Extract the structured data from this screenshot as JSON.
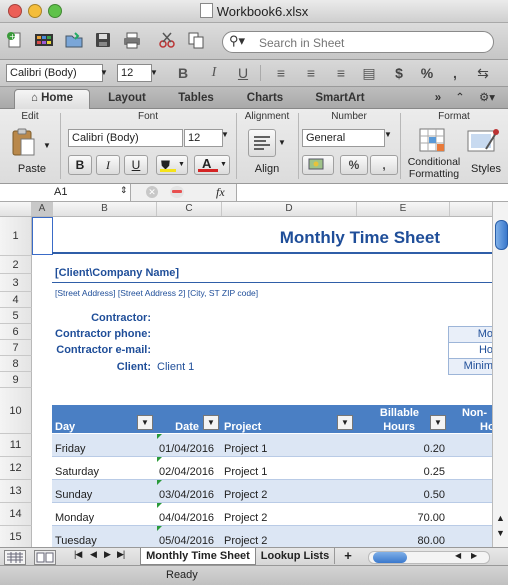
{
  "window": {
    "title": "Workbook6.xlsx"
  },
  "toolbar": {
    "search_placeholder": "Search in Sheet"
  },
  "formatbar": {
    "font_name": "Calibri (Body)",
    "font_size": "12",
    "bold": "B",
    "italic": "I",
    "underline": "U",
    "currency": "$",
    "percent": "%",
    "comma": ","
  },
  "ribbon_tabs": [
    "Home",
    "Layout",
    "Tables",
    "Charts",
    "SmartArt"
  ],
  "ribbon": {
    "groups": {
      "edit": "Edit",
      "font": "Font",
      "alignment": "Alignment",
      "number": "Number",
      "format": "Format"
    },
    "paste_label": "Paste",
    "font_name": "Calibri (Body)",
    "font_size": "12",
    "bold": "B",
    "italic": "I",
    "underline": "U",
    "align_label": "Align",
    "number_format": "General",
    "percent": "%",
    "comma": ",",
    "conditional_line1": "Conditional",
    "conditional_line2": "Formatting",
    "styles_label": "Styles"
  },
  "formula_bar": {
    "cell_ref": "A1",
    "fx": "fx"
  },
  "columns": [
    "A",
    "B",
    "C",
    "D",
    "E"
  ],
  "rows": [
    "1",
    "2",
    "3",
    "4",
    "5",
    "6",
    "7",
    "8",
    "9",
    "10",
    "11",
    "12",
    "13",
    "14",
    "15"
  ],
  "sheet": {
    "title": "Monthly Time Sheet",
    "company": "[Client\\Company Name]",
    "address": "[Street Address] [Street Address 2] [City, ST ZIP code]",
    "contractor_label": "Contractor:",
    "phone_label": "Contractor phone:",
    "email_label": "Contractor e-mail:",
    "client_label": "Client:",
    "client_value": "Client 1",
    "side_labels": [
      "Mo",
      "Ho",
      "Minim"
    ],
    "table_headers": {
      "day": "Day",
      "date": "Date",
      "project": "Project",
      "billable_1": "Billable",
      "billable_2": "Hours",
      "nonbill_1": "Non-",
      "nonbill_2": "Ho"
    },
    "table_rows": [
      {
        "day": "Friday",
        "date": "01/04/2016",
        "project": "Project 1",
        "hours": "0.20"
      },
      {
        "day": "Saturday",
        "date": "02/04/2016",
        "project": "Project 1",
        "hours": "0.25"
      },
      {
        "day": "Sunday",
        "date": "03/04/2016",
        "project": "Project 2",
        "hours": "0.50"
      },
      {
        "day": "Monday",
        "date": "04/04/2016",
        "project": "Project 2",
        "hours": "70.00"
      },
      {
        "day": "Tuesday",
        "date": "05/04/2016",
        "project": "Project 2",
        "hours": "80.00"
      }
    ]
  },
  "sheet_tabs": [
    "Monthly Time Sheet",
    "Lookup Lists"
  ],
  "status": {
    "text": "Ready"
  },
  "colors": {
    "accent_blue": "#1f4e99",
    "table_header": "#4a7fc4",
    "band": "#dce6f4"
  }
}
